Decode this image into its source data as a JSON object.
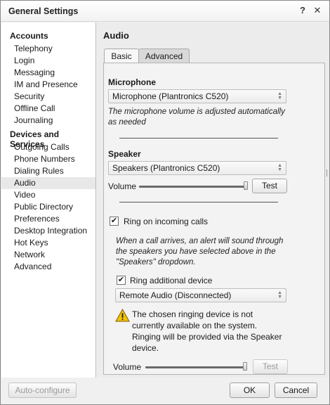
{
  "window": {
    "title": "General Settings",
    "help_label": "?",
    "close_label": "✕"
  },
  "sidebar": {
    "sections": [
      {
        "title": "Accounts",
        "items": [
          "Telephony",
          "Login",
          "Messaging",
          "IM and Presence",
          "Security",
          "Offline Call Journaling"
        ]
      },
      {
        "title": "Devices and Services",
        "items": [
          "Outgoing Calls",
          "Phone Numbers",
          "Dialing Rules",
          "Audio",
          "Video",
          "Public Directory",
          "Preferences",
          "Desktop Integration",
          "Hot Keys",
          "Network",
          "Advanced"
        ]
      }
    ],
    "selected": "Audio"
  },
  "main": {
    "title": "Audio",
    "tabs": [
      {
        "label": "Basic",
        "active": false
      },
      {
        "label": "Advanced",
        "active": true
      }
    ]
  },
  "advanced": {
    "microphone": {
      "heading": "Microphone",
      "device": "Microphone (Plantronics C520)",
      "note": "The microphone volume is adjusted automatically as needed"
    },
    "speaker": {
      "heading": "Speaker",
      "device": "Speakers (Plantronics C520)",
      "volume_label": "Volume",
      "volume_level": 1.0,
      "test_label": "Test"
    },
    "ring": {
      "ring_incoming_label": "Ring on incoming calls",
      "ring_incoming_checked": true,
      "note": "When a call arrives, an alert will sound through the speakers you have selected above in the \"Speakers\" dropdown.",
      "ring_additional_label": "Ring additional device",
      "ring_additional_checked": true,
      "additional_device": "Remote Audio (Disconnected)",
      "warning": "The chosen ringing device is not currently available on the system. Ringing will be provided via the Speaker device.",
      "volume_label": "Volume",
      "volume_level": 1.0,
      "test_label": "Test"
    }
  },
  "footer": {
    "auto_configure_label": "Auto-configure",
    "ok_label": "OK",
    "cancel_label": "Cancel"
  },
  "colors": {
    "warning_fill": "#f5c400",
    "window_bg": "#f0f0f0",
    "sidebar_bg": "#ffffff"
  },
  "check_glyph": "✔"
}
